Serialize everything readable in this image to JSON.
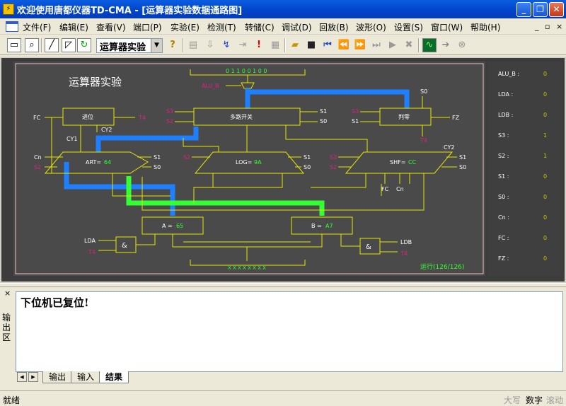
{
  "window": {
    "title": "欢迎使用唐都仪器TD-CMA - [运算器实验数据通路图]",
    "minimize": "_",
    "restore": "❐",
    "close": "✕"
  },
  "menu": {
    "items": [
      "文件(F)",
      "编辑(E)",
      "查看(V)",
      "端口(P)",
      "实验(E)",
      "检测(T)",
      "转储(C)",
      "调试(D)",
      "回放(B)",
      "波形(O)",
      "设置(S)",
      "窗口(W)",
      "帮助(H)"
    ],
    "mdi_minimize": "_",
    "mdi_restore": "▫",
    "mdi_close": "×"
  },
  "toolbar": {
    "experiment_select": "运算器实验"
  },
  "diagram": {
    "title": "运算器实验",
    "top_bus_value": "0 1 1 0 0 1 0 0",
    "bottom_bus_value": "X X X X X X X X",
    "alu_b_signal": "ALU_B",
    "carry_box": "进位",
    "mux_box": "多路开关",
    "zero_box": "判零",
    "art_label": "ART=",
    "art_value": "64",
    "log_label": "LOG=",
    "log_value": "9A",
    "shf_label": "SHF=",
    "shf_value": "CC",
    "reg_a_label": "A =",
    "reg_a_value": "65",
    "reg_b_label": "B =",
    "reg_b_value": "A7",
    "and_symbol": "&",
    "run_status": "运行(126/126)",
    "signals": {
      "fc": "FC",
      "fz": "FZ",
      "cy1": "CY1",
      "cy2": "CY2",
      "cn": "Cn",
      "s0": "S0",
      "s1": "S1",
      "s2": "S2",
      "s3": "S3",
      "t4": "T4",
      "lda": "LDA",
      "ldb": "LDB"
    },
    "colors": {
      "background": "#4a4a4a",
      "wire": "#e6e600",
      "bus_blue": "#1e7fff",
      "bus_green": "#33ff33",
      "control_signal": "#e0207f",
      "frame": "#ffffff"
    }
  },
  "registers": [
    {
      "name": "ALU_B :",
      "value": "0"
    },
    {
      "name": "LDA :",
      "value": "0"
    },
    {
      "name": "LDB :",
      "value": "0"
    },
    {
      "name": "S3 :",
      "value": "1"
    },
    {
      "name": "S2 :",
      "value": "1"
    },
    {
      "name": "S1 :",
      "value": "0"
    },
    {
      "name": "S0 :",
      "value": "0"
    },
    {
      "name": "Cn :",
      "value": "0"
    },
    {
      "name": "FC :",
      "value": "0"
    },
    {
      "name": "FZ :",
      "value": "0"
    }
  ],
  "output": {
    "dock_title": "输出区",
    "text": "下位机已复位!",
    "tabs": [
      "输出",
      "输入",
      "结果"
    ],
    "active_tab": "结果"
  },
  "status": {
    "text": "就绪",
    "caps": "大写",
    "num": "数字",
    "scroll": "滚动"
  }
}
